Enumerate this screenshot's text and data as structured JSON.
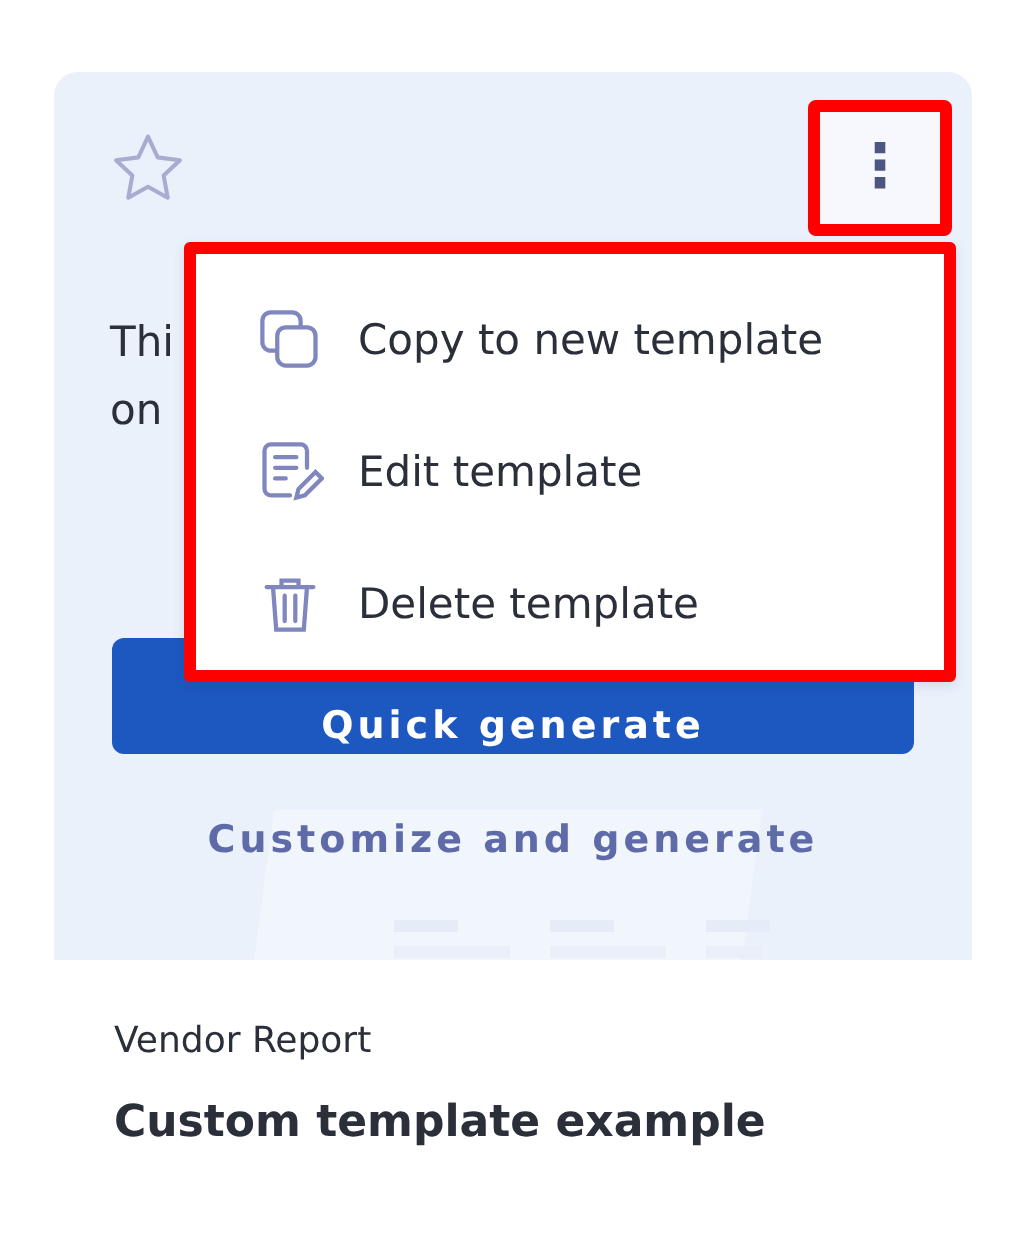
{
  "card": {
    "starred": false,
    "more_button": {
      "label": "⋮",
      "highlighted": true
    },
    "description_lines": [
      "Thi",
      "on"
    ],
    "primary_button": "Quick generate",
    "secondary_link": "Customize and generate"
  },
  "menu": {
    "highlighted": true,
    "items": [
      {
        "kind": "copy",
        "label": "Copy to new template"
      },
      {
        "kind": "edit",
        "label": "Edit template"
      },
      {
        "kind": "delete",
        "label": "Delete template"
      }
    ]
  },
  "category": "Vendor Report",
  "title": "Custom template example"
}
